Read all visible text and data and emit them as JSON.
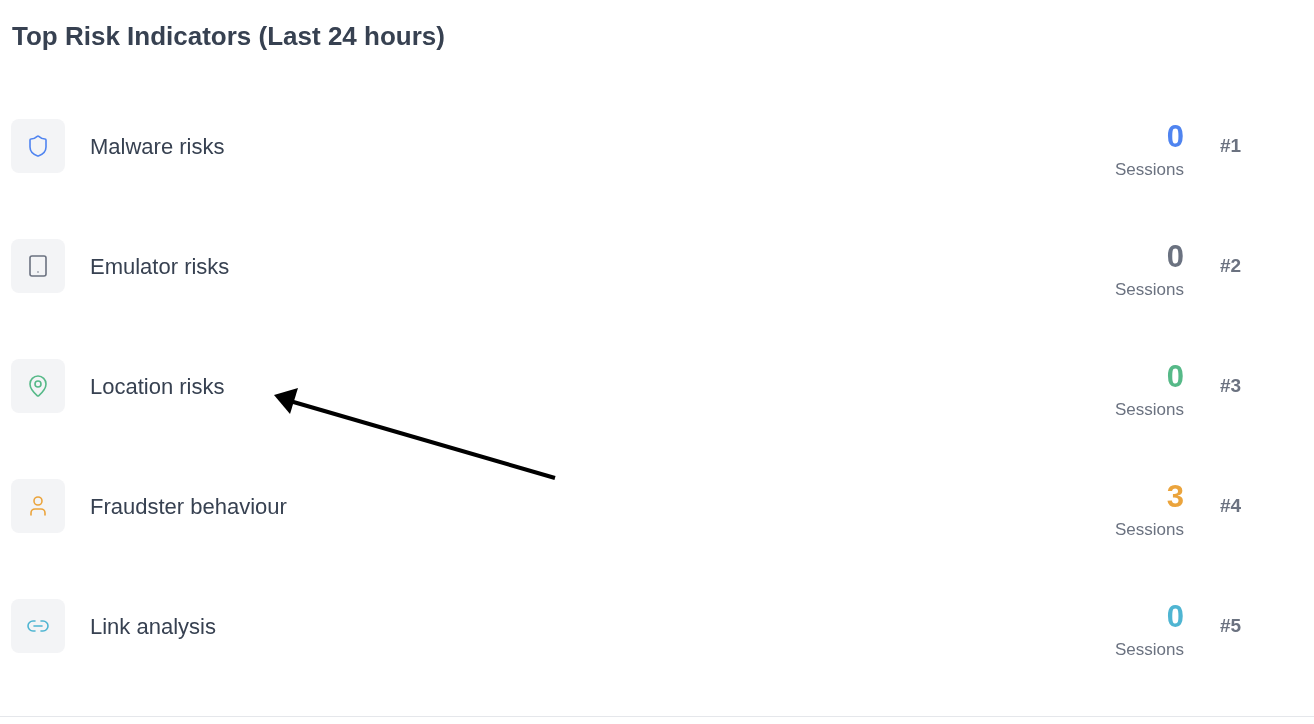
{
  "title": "Top Risk Indicators (Last 24 hours)",
  "indicators": [
    {
      "kind": "shield",
      "label": "Malware risks",
      "count": "0",
      "unit": "Sessions",
      "rank": "#1",
      "color": "#4f84f0"
    },
    {
      "kind": "tablet",
      "label": "Emulator risks",
      "count": "0",
      "unit": "Sessions",
      "rank": "#2",
      "color": "#6b7280"
    },
    {
      "kind": "pin",
      "label": "Location risks",
      "count": "0",
      "unit": "Sessions",
      "rank": "#3",
      "color": "#56b988"
    },
    {
      "kind": "person",
      "label": "Fraudster behaviour",
      "count": "3",
      "unit": "Sessions",
      "rank": "#4",
      "color": "#eba43c"
    },
    {
      "kind": "link",
      "label": "Link analysis",
      "count": "0",
      "unit": "Sessions",
      "rank": "#5",
      "color": "#4fb5d2"
    }
  ]
}
